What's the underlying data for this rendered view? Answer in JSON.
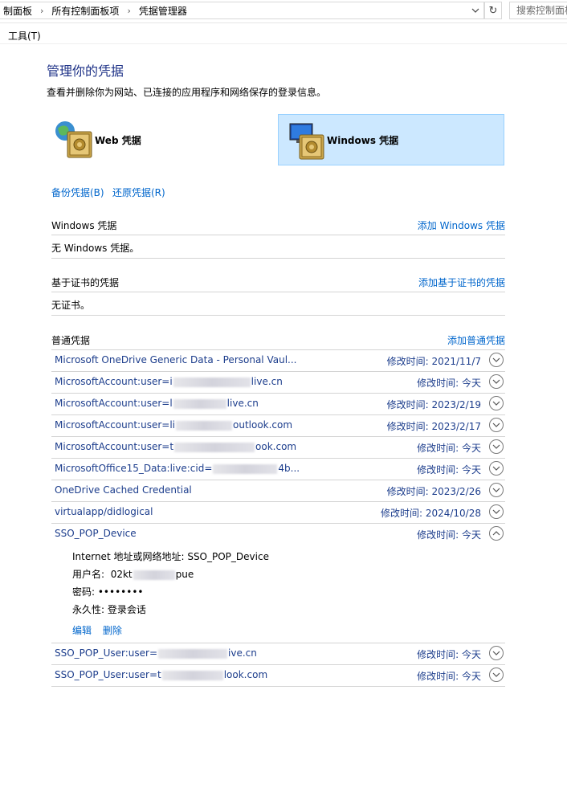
{
  "address_bar": {
    "crumbs": [
      "制面板",
      "所有控制面板项",
      "凭据管理器"
    ],
    "search_placeholder": "搜索控制面板"
  },
  "menu": {
    "tools": "工具(T)"
  },
  "page": {
    "title": "管理你的凭据",
    "subtitle": "查看并删除你为网站、已连接的应用程序和网络保存的登录信息。"
  },
  "vault_tabs": {
    "web": "Web 凭据",
    "windows": "Windows 凭据"
  },
  "actions": {
    "backup": "备份凭据(B)",
    "restore": "还原凭据(R)"
  },
  "sections": {
    "windows": {
      "title": "Windows 凭据",
      "add": "添加 Windows 凭据",
      "empty": "无 Windows 凭据。"
    },
    "cert": {
      "title": "基于证书的凭据",
      "add": "添加基于证书的凭据",
      "empty": "无证书。"
    },
    "generic": {
      "title": "普通凭据",
      "add": "添加普通凭据"
    }
  },
  "credentials": [
    {
      "pre": "Microsoft OneDrive Generic Data - Personal Vaul...",
      "post": "",
      "modified": "修改时间:  2021/11/7"
    },
    {
      "pre": "MicrosoftAccount:user=i",
      "post": "live.cn",
      "modified": "修改时间:  今天"
    },
    {
      "pre": "MicrosoftAccount:user=l",
      "post": "live.cn",
      "modified": "修改时间:  2023/2/19"
    },
    {
      "pre": "MicrosoftAccount:user=li",
      "post": "outlook.com",
      "modified": "修改时间:  2023/2/17"
    },
    {
      "pre": "MicrosoftAccount:user=t",
      "post": "ook.com",
      "modified": "修改时间:  今天"
    },
    {
      "pre": "MicrosoftOffice15_Data:live:cid=",
      "post": "4b...",
      "modified": "修改时间:  今天"
    },
    {
      "pre": "OneDrive Cached Credential",
      "post": "",
      "modified": "修改时间:  2023/2/26"
    },
    {
      "pre": "virtualapp/didlogical",
      "post": "",
      "modified": "修改时间:  2024/10/28"
    },
    {
      "pre": "SSO_POP_Device",
      "post": "",
      "modified": "修改时间:  今天"
    }
  ],
  "expanded": {
    "internet_address": "Internet 地址或网络地址:  SSO_POP_Device",
    "username_label": "用户名:",
    "username_pre": "02kt",
    "username_post": "pue",
    "password": "密码:  ••••••••",
    "persistence": "永久性:  登录会话",
    "edit": "编辑",
    "delete": "删除"
  },
  "credentials_after": [
    {
      "pre": "SSO_POP_User:user=",
      "post": "ive.cn",
      "modified": "修改时间:  今天"
    },
    {
      "pre": "SSO_POP_User:user=t",
      "post": "look.com",
      "modified": "修改时间:  今天"
    }
  ]
}
